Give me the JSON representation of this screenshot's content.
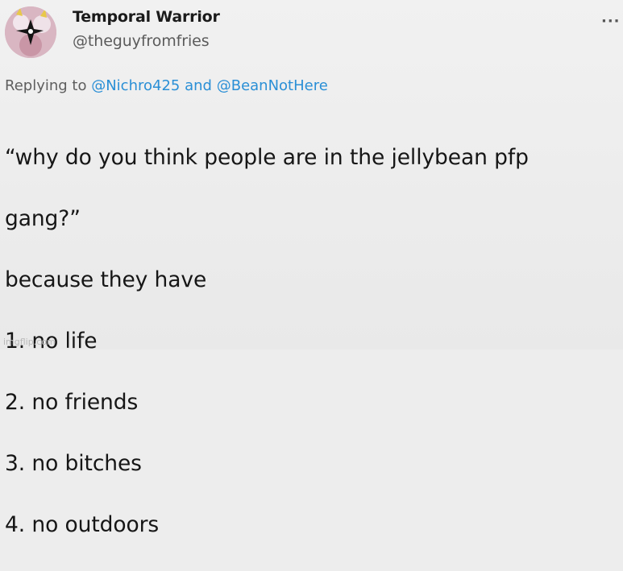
{
  "user": {
    "display_name": "Temporal Warrior",
    "handle": "@theguyfromfries"
  },
  "header": {
    "more_icon": "more-horizontal-icon",
    "more_label": "···"
  },
  "reply": {
    "prefix": "Replying to",
    "mention_1": "@Nichro425",
    "connector": "and",
    "mention_2": "@BeanNotHere",
    "mention_color": "#2a8fd6"
  },
  "tweet": {
    "lines": [
      "“why do you think people are in the jellybean pfp",
      "gang?”",
      "because they have",
      "1. no life",
      "2. no friends",
      "3. no bitches",
      "4. no outdoors"
    ]
  },
  "watermark": {
    "text": "imgflip.com"
  }
}
